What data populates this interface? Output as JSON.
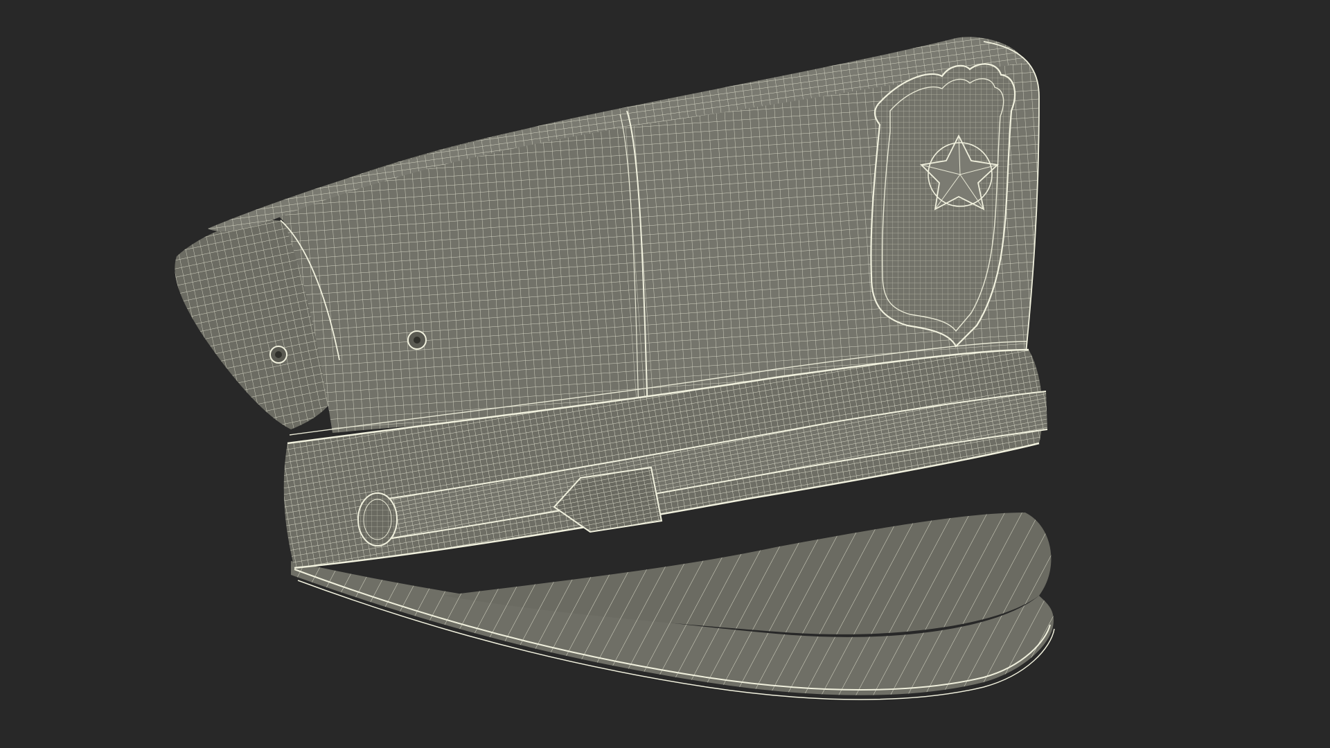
{
  "scene": {
    "subject": "peaked-cap-wireframe-render",
    "colors": {
      "background": "#282828",
      "surface": "#6f6f66",
      "surface_dark": "#5a5a52",
      "surface_light": "#83837a",
      "wire": "#e9e9d6",
      "wire_soft": "#d6d6c2",
      "rim": "#f1f1de"
    }
  }
}
